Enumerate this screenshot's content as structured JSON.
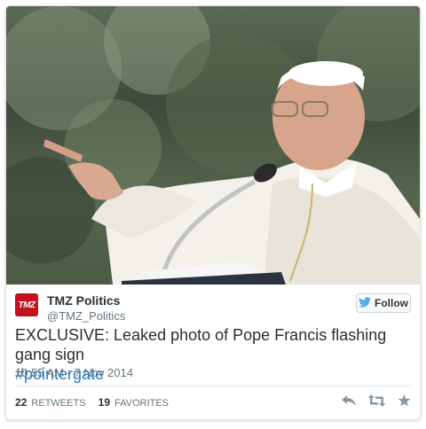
{
  "tweet": {
    "author_name": "TMZ Politics",
    "author_handle": "@TMZ_Politics",
    "avatar_text": "TMZ",
    "follow_label": "Follow",
    "text": "EXCLUSIVE: Leaked photo of Pope Francis flashing gang sign",
    "hashtag": "#pointergate",
    "timestamp": "10:55 AM - 7 Nov 2014",
    "retweets_count": "22",
    "retweets_label": "RETWEETS",
    "favorites_count": "19",
    "favorites_label": "FAVORITES"
  },
  "icons": {
    "follow": "twitter-bird-icon",
    "reply": "reply-icon",
    "retweet": "retweet-icon",
    "favorite": "star-icon"
  },
  "colors": {
    "text": "#292f33",
    "secondary": "#66757f",
    "link": "#2b7bb9",
    "avatar_bg": "#c1121f",
    "twitter_blue": "#55acee"
  }
}
